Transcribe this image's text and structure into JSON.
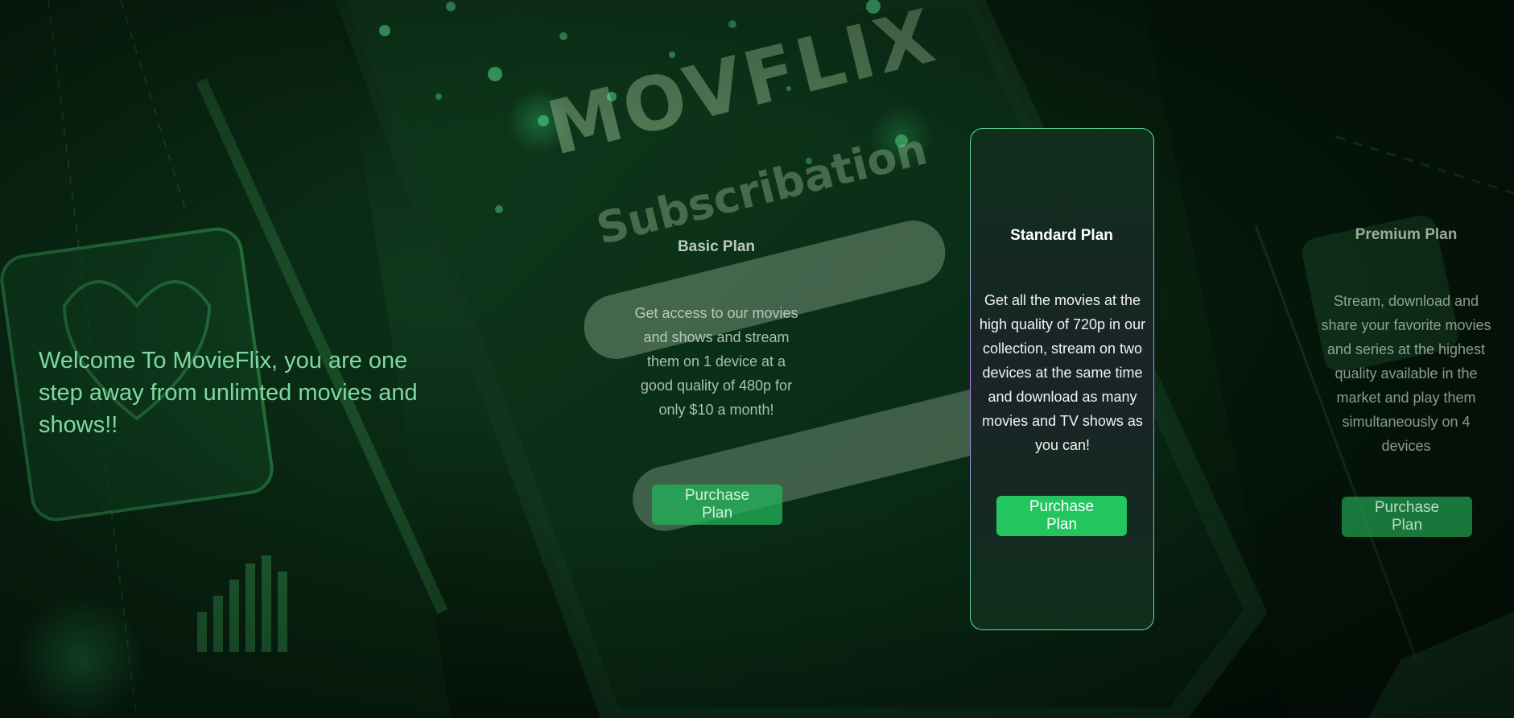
{
  "hero": {
    "welcome_text": "Welcome To MovieFlix, you are one step away from unlimted movies and shows!!",
    "background_brand": "MOVFLIX",
    "background_subtitle": "Subscribation"
  },
  "plans": [
    {
      "title": "Basic Plan",
      "description": "Get access to our movies and shows and stream them on 1 device at a good quality of 480p for only $10 a month!",
      "button_label": "Purchase Plan"
    },
    {
      "title": "Standard Plan",
      "description": "Get all the movies at the high quality of 720p in our collection, stream on two devices at the same time and download as many movies and TV shows as you can!",
      "button_label": "Purchase Plan",
      "highlighted": true
    },
    {
      "title": "Premium Plan",
      "description": "Stream, download and share your favorite movies and series at the highest quality available in the market and play them simultaneously on 4 devices",
      "button_label": "Purchase Plan"
    }
  ],
  "colors": {
    "accent_green": "#22c55e",
    "welcome_text": "#7fd8a0",
    "card_border_gradient": [
      "#5fe39a",
      "#c084fc"
    ],
    "background": "#08220f"
  }
}
